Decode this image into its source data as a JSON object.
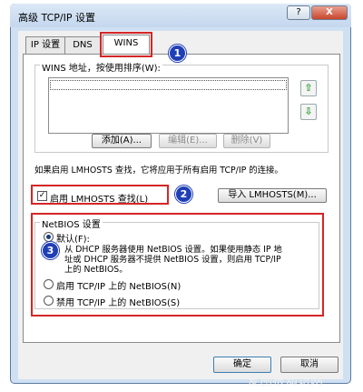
{
  "window": {
    "title": "高级 TCP/IP 设置",
    "help_label": "?",
    "close_label": "X"
  },
  "tabs": [
    {
      "label": "IP 设置"
    },
    {
      "label": "DNS"
    },
    {
      "label": "WINS"
    }
  ],
  "wins": {
    "list_label": "WINS 地址，按使用排序(W):",
    "up_arrow": "⇧",
    "down_arrow": "⇩",
    "add_label": "添加(A)...",
    "edit_label": "编辑(E)...",
    "remove_label": "删除(V)"
  },
  "lmhosts": {
    "description": "如果启用 LMHOSTS 查找，它将应用于所有启用 TCP/IP 的连接。",
    "checkbox_label": "启用 LMHOSTS 查找(L)",
    "checked": true,
    "import_label": "导入 LMHOSTS(M)..."
  },
  "netbios": {
    "group_label": "NetBIOS 设置",
    "default_label": "默认(F):",
    "default_desc_1": "从 DHCP 服务器使用 NetBIOS 设置。如果使用静态 IP 地",
    "default_desc_2": "址或 DHCP 服务器不提供 NetBIOS 设置，则启用 TCP/IP",
    "default_desc_3": "上的 NetBIOS。",
    "enable_label": "启用 TCP/IP 上的 NetBIOS(N)",
    "disable_label": "禁用 TCP/IP 上的 NetBIOS(S)",
    "selected": "default"
  },
  "footer": {
    "ok_label": "确定",
    "cancel_label": "取消"
  },
  "annotations": {
    "badge_1": "1",
    "badge_2": "2",
    "badge_3": "3",
    "color": "#d42626",
    "badge_color": "#1f3fb6"
  },
  "watermark": {
    "text": "爱刨根知识网"
  }
}
